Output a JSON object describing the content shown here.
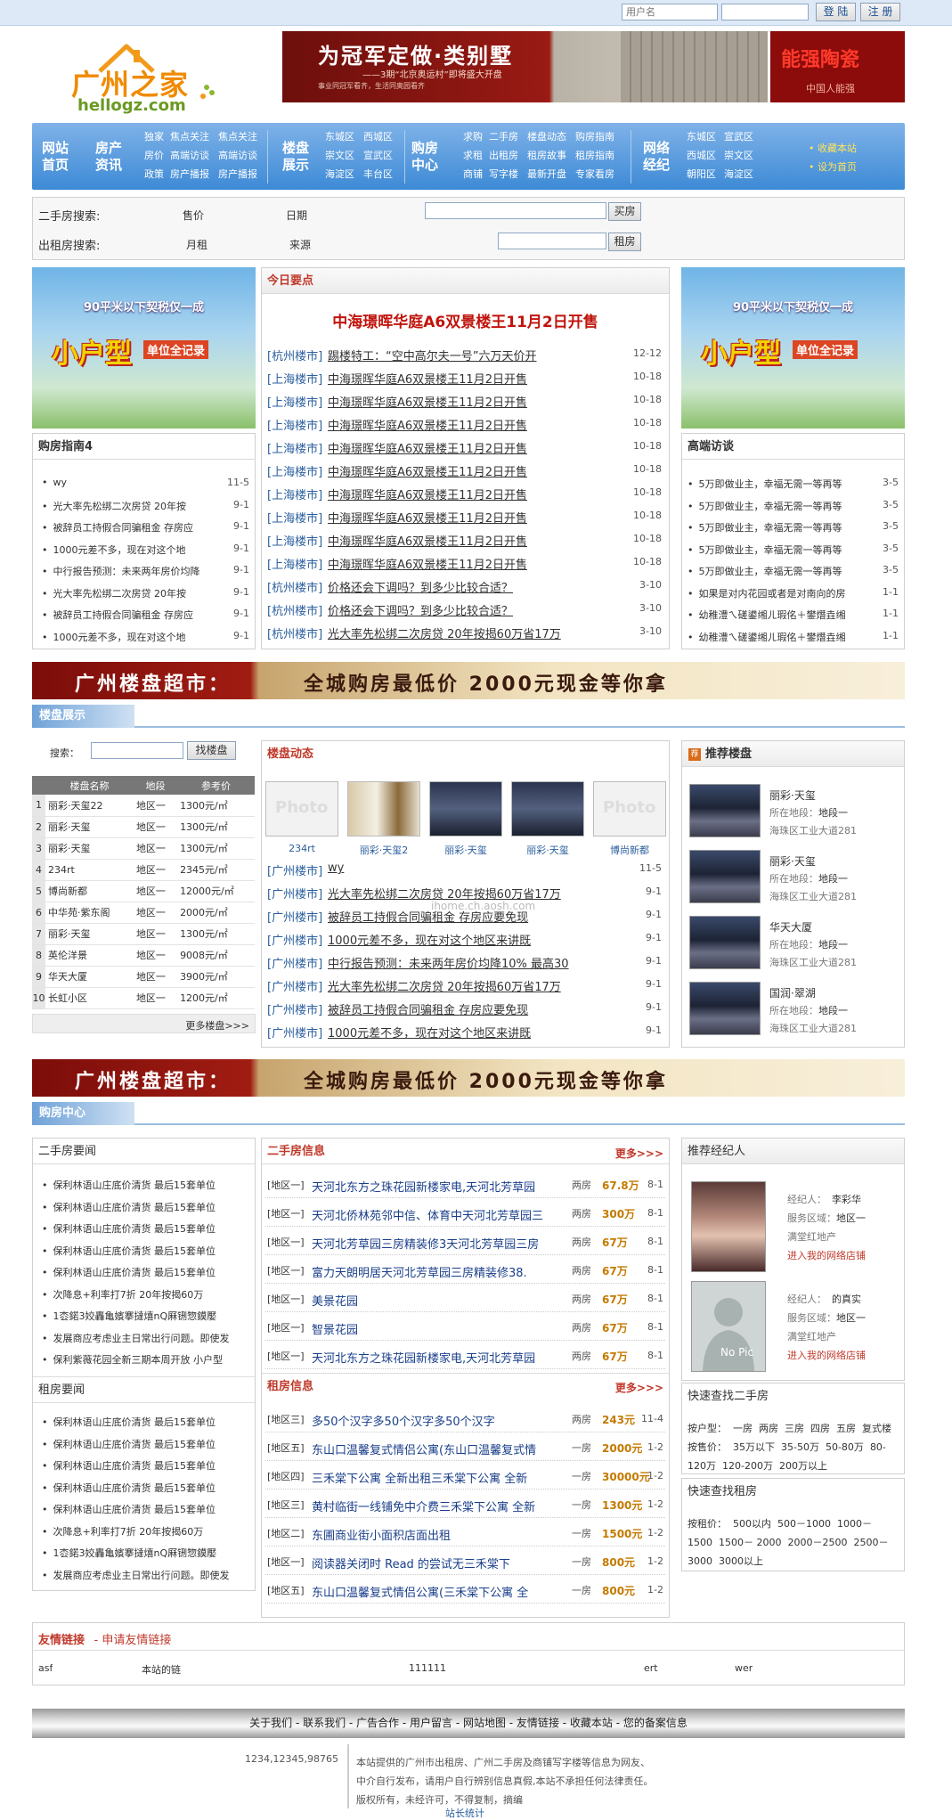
{
  "topbar": {
    "username_placeholder": "用户名",
    "login": "登 陆",
    "register": "注 册"
  },
  "logo": {
    "cn": "广州之家",
    "en": "hellogz.com"
  },
  "header_banner": {
    "headline": "为冠军定做·类别墅",
    "sub": "——3期“北京奥运村”即将盛大开盘",
    "fine": "事业同冠军看齐，生活同奥园看齐",
    "side": "能强陶瓷",
    "side_sub": "中国人能强"
  },
  "nav": {
    "groups": [
      {
        "big": [
          "网站",
          "首页"
        ]
      },
      {
        "big": [
          "房产",
          "资讯"
        ]
      },
      {
        "big": [
          "楼盘",
          "展示"
        ]
      },
      {
        "big": [
          "购房",
          "中心"
        ]
      },
      {
        "big": [
          "网络",
          "经纪"
        ]
      }
    ],
    "col1": [
      "独家",
      "房价",
      "政策"
    ],
    "col2": [
      "焦点关注",
      "高端访谈",
      "房产播报"
    ],
    "col3": [
      "焦点关注",
      "高端访谈",
      "房产播报"
    ],
    "col4": [
      "东城区",
      "崇文区",
      "海淀区"
    ],
    "col5": [
      "西城区",
      "宣武区",
      "丰台区"
    ],
    "col6": [
      "求购",
      "求租",
      "商铺"
    ],
    "col7": [
      "二手房",
      "出租房",
      "写字楼"
    ],
    "col8": [
      "楼盘动态",
      "租房故事",
      "最新开盘"
    ],
    "col9": [
      "购房指南",
      "租房指南",
      "专家看房"
    ],
    "col10": [
      "东城区",
      "西城区",
      "朝阳区"
    ],
    "col11": [
      "宣武区",
      "崇文区",
      "海淀区"
    ],
    "extra": [
      "收藏本站",
      "设为首页"
    ]
  },
  "search": {
    "used_label": "二手房搜索:",
    "used_f1": "售价",
    "used_f2": "日期",
    "used_btn": "买房",
    "rent_label": "出租房搜索:",
    "rent_f1": "月租",
    "rent_f2": "来源",
    "rent_btn": "租房"
  },
  "ad": {
    "line1": "90平米以下契税仅一成",
    "big": "小户型",
    "tag": "单位全记录"
  },
  "guide": {
    "title": "购房指南4",
    "items": [
      {
        "t": "wy",
        "d": "11-5"
      },
      {
        "t": "光大率先松绑二次房贷 20年按",
        "d": "9-1"
      },
      {
        "t": "被辞员工持假合同骗租金 存房应",
        "d": "9-1"
      },
      {
        "t": "1000元差不多，现在对这个地",
        "d": "9-1"
      },
      {
        "t": "中行报告预测：未来两年房价均降",
        "d": "9-1"
      },
      {
        "t": "光大率先松绑二次房贷 20年按",
        "d": "9-1"
      },
      {
        "t": "被辞员工持假合同骗租金 存房应",
        "d": "9-1"
      },
      {
        "t": "1000元差不多，现在对这个地",
        "d": "9-1"
      }
    ]
  },
  "today": {
    "title": "今日要点",
    "headline": "中海璟晖华庭A6双景楼王11月2日开售",
    "items": [
      {
        "c": "[杭州楼市]",
        "t": "踢楼特工：“空中高尔夫一号”六万天价开",
        "d": "12-12"
      },
      {
        "c": "[上海楼市]",
        "t": "中海璟晖华庭A6双景楼王11月2日开售",
        "d": "10-18"
      },
      {
        "c": "[上海楼市]",
        "t": "中海璟晖华庭A6双景楼王11月2日开售",
        "d": "10-18"
      },
      {
        "c": "[上海楼市]",
        "t": "中海璟晖华庭A6双景楼王11月2日开售",
        "d": "10-18"
      },
      {
        "c": "[上海楼市]",
        "t": "中海璟晖华庭A6双景楼王11月2日开售",
        "d": "10-18"
      },
      {
        "c": "[上海楼市]",
        "t": "中海璟晖华庭A6双景楼王11月2日开售",
        "d": "10-18"
      },
      {
        "c": "[上海楼市]",
        "t": "中海璟晖华庭A6双景楼王11月2日开售",
        "d": "10-18"
      },
      {
        "c": "[上海楼市]",
        "t": "中海璟晖华庭A6双景楼王11月2日开售",
        "d": "10-18"
      },
      {
        "c": "[上海楼市]",
        "t": "中海璟晖华庭A6双景楼王11月2日开售",
        "d": "10-18"
      },
      {
        "c": "[上海楼市]",
        "t": "中海璟晖华庭A6双景楼王11月2日开售",
        "d": "10-18"
      },
      {
        "c": "[杭州楼市]",
        "t": "价格还会下调吗？到多少比较合适？",
        "d": "3-10"
      },
      {
        "c": "[杭州楼市]",
        "t": "价格还会下调吗？到多少比较合适？",
        "d": "3-10"
      },
      {
        "c": "[杭州楼市]",
        "t": "光大率先松绑二次房贷 20年按揭60万省17万",
        "d": "3-10"
      }
    ]
  },
  "interview": {
    "title": "高端访谈",
    "items": [
      {
        "t": "5万即做业主，幸福无需一等再等",
        "d": "3-5"
      },
      {
        "t": "5万即做业主，幸福无需一等再等",
        "d": "3-5"
      },
      {
        "t": "5万即做业主，幸福无需一等再等",
        "d": "3-5"
      },
      {
        "t": "5万即做业主，幸福无需一等再等",
        "d": "3-5"
      },
      {
        "t": "5万即做业主，幸福无需一等再等",
        "d": "3-5"
      },
      {
        "t": "如果是对内花园或者是对南向的房",
        "d": "1-1"
      },
      {
        "t": "幼稚澧ㄟ磋鍙缃ㄦ瑕佲＋鐢熸垚缃",
        "d": "1-1"
      },
      {
        "t": "幼稚澧ㄟ磋鍙缃ㄦ瑕佲＋鐢熸垚缃",
        "d": "1-1"
      }
    ]
  },
  "banner": {
    "left": "广州楼盘超市：",
    "right": "全城购房最低价 2000元现金等你拿"
  },
  "sect1": "楼盘展示",
  "sect2": "购房中心",
  "listing": {
    "search_label": "搜索：",
    "search_btn": "找楼盘",
    "headers": [
      "楼盘名称",
      "地段",
      "参考价"
    ],
    "rows": [
      {
        "n": "1",
        "name": "丽彩·天玺22",
        "area": "地区一",
        "p": "1300元/㎡"
      },
      {
        "n": "2",
        "name": "丽彩·天玺",
        "area": "地区一",
        "p": "1300元/㎡"
      },
      {
        "n": "3",
        "name": "丽彩·天玺",
        "area": "地区一",
        "p": "1300元/㎡"
      },
      {
        "n": "4",
        "name": "234rt",
        "area": "地区一",
        "p": "2345元/㎡"
      },
      {
        "n": "5",
        "name": "博尚新都",
        "area": "地区一",
        "p": "12000元/㎡"
      },
      {
        "n": "6",
        "name": "中华苑·紫东阁",
        "area": "地区一",
        "p": "2000元/㎡"
      },
      {
        "n": "7",
        "name": "丽彩·天玺",
        "area": "地区一",
        "p": "1300元/㎡"
      },
      {
        "n": "8",
        "name": "英伦洋景",
        "area": "地区一",
        "p": "9008元/㎡"
      },
      {
        "n": "9",
        "name": "华天大厦",
        "area": "地区一",
        "p": "3900元/㎡"
      },
      {
        "n": "10",
        "name": "长虹小区",
        "area": "地区一",
        "p": "1200元/㎡"
      }
    ],
    "more": "更多楼盘>>>"
  },
  "dynamics": {
    "title": "楼盘动态",
    "photos": [
      "234rt",
      "丽彩·天玺2",
      "丽彩·天玺",
      "丽彩·天玺",
      "博尚新都"
    ],
    "photo_placeholder": "Photo",
    "watermark": "ihome.ch.aosh.com",
    "items": [
      {
        "c": "[广州楼市]",
        "t": "wy",
        "d": "11-5"
      },
      {
        "c": "[广州楼市]",
        "t": "光大率先松绑二次房贷 20年按揭60万省17万",
        "d": "9-1"
      },
      {
        "c": "[广州楼市]",
        "t": "被辞员工持假合同骗租金 存房应要免现",
        "d": "9-1"
      },
      {
        "c": "[广州楼市]",
        "t": "1000元差不多，现在对这个地区来讲既",
        "d": "9-1"
      },
      {
        "c": "[广州楼市]",
        "t": "中行报告预测：未来两年房价均降10% 最高30",
        "d": "9-1"
      },
      {
        "c": "[广州楼市]",
        "t": "光大率先松绑二次房贷 20年按揭60万省17万",
        "d": "9-1"
      },
      {
        "c": "[广州楼市]",
        "t": "被辞员工持假合同骗租金 存房应要免现",
        "d": "9-1"
      },
      {
        "c": "[广州楼市]",
        "t": "1000元差不多，现在对这个地区来讲既",
        "d": "9-1"
      }
    ]
  },
  "recommend": {
    "title": "推荐楼盘",
    "loc_label": "所在地段：",
    "addr_label": "",
    "items": [
      {
        "name": "丽彩·天玺",
        "loc": "地段一",
        "addr": "海珠区工业大道281"
      },
      {
        "name": "丽彩·天玺",
        "loc": "地段一",
        "addr": "海珠区工业大道281"
      },
      {
        "name": "华天大厦",
        "loc": "地段一",
        "addr": "海珠区工业大道281"
      },
      {
        "name": "国润·翠湖",
        "loc": "地段一",
        "addr": "海珠区工业大道281"
      }
    ]
  },
  "used_news": {
    "title": "二手房要闻",
    "items": [
      "保利林语山庄底价清货 最后15套单位",
      "保利林语山庄底价清货 最后15套单位",
      "保利林语山庄底价清货 最后15套单位",
      "保利林语山庄底价清货 最后15套单位",
      "保利林语山庄底价清货 最后15套单位",
      "次降息+利率打7折 20年按揭60万",
      "1枩鍩3姣轟亀嬪搴撻熺nQ厤铏惣鏌嬮",
      "发展商应考虑业主日常出行问题。即使发",
      "保利紫薇花园全新三期本周开放 小户型"
    ]
  },
  "rent_news": {
    "title": "租房要闻",
    "items": [
      "保利林语山庄底价清货 最后15套单位",
      "保利林语山庄底价清货 最后15套单位",
      "保利林语山庄底价清货 最后15套单位",
      "保利林语山庄底价清货 最后15套单位",
      "保利林语山庄底价清货 最后15套单位",
      "次降息+利率打7折 20年按揭60万",
      "1枩鍩3姣轟亀嬪搴撻熺nQ厤铏惣鏌嬮",
      "发展商应考虑业主日常出行问题。即使发"
    ]
  },
  "used_info": {
    "title": "二手房信息",
    "more": "更多>>>",
    "items": [
      {
        "a": "[地区一]",
        "t": "天河北东方之珠花园新楼家电,天河北芳草园",
        "r": "两房",
        "p": "67.8万",
        "d": "8-1"
      },
      {
        "a": "[地区一]",
        "t": "天河北侨林苑邻中信、体育中天河北芳草园三",
        "r": "两房",
        "p": "300万",
        "d": "8-1"
      },
      {
        "a": "[地区一]",
        "t": "天河北芳草园三房精装修3天河北芳草园三房",
        "r": "两房",
        "p": "67万",
        "d": "8-1"
      },
      {
        "a": "[地区一]",
        "t": "富力天朗明居天河北芳草园三房精装修38.",
        "r": "两房",
        "p": "67万",
        "d": "8-1"
      },
      {
        "a": "[地区一]",
        "t": "美景花园",
        "r": "两房",
        "p": "67万",
        "d": "8-1"
      },
      {
        "a": "[地区一]",
        "t": "智景花园",
        "r": "两房",
        "p": "67万",
        "d": "8-1"
      },
      {
        "a": "[地区一]",
        "t": "天河北东方之珠花园新楼家电,天河北芳草园",
        "r": "两房",
        "p": "67万",
        "d": "8-1"
      }
    ]
  },
  "rent_info": {
    "title": "租房信息",
    "more": "更多>>>",
    "items": [
      {
        "a": "[地区三]",
        "t": "多50个汉字多50个汉字多50个汉字",
        "r": "两房",
        "p": "243元",
        "d": "11-4"
      },
      {
        "a": "[地区五]",
        "t": "东山口温馨复式情侣公寓(东山口温馨复式情",
        "r": "一房",
        "p": "2000元",
        "d": "1-2"
      },
      {
        "a": "[地区四]",
        "t": "三禾棠下公寓 全新出租三禾棠下公寓 全新",
        "r": "一房",
        "p": "30000元",
        "d": "1-2"
      },
      {
        "a": "[地区三]",
        "t": "黄村临街一线铺免中介费三禾棠下公寓 全新",
        "r": "一房",
        "p": "1300元",
        "d": "1-2"
      },
      {
        "a": "[地区二]",
        "t": "东圃商业街小面积店面出租",
        "r": "一房",
        "p": "1500元",
        "d": "1-2"
      },
      {
        "a": "[地区一]",
        "t": "阅读器关闭时 Read 的尝试无三禾棠下",
        "r": "一房",
        "p": "800元",
        "d": "1-2"
      },
      {
        "a": "[地区五]",
        "t": "东山口温馨复式情侣公寓(三禾棠下公寓 全",
        "r": "一房",
        "p": "800元",
        "d": "1-2"
      }
    ]
  },
  "agent": {
    "title": "推荐经纪人",
    "name_label": "经纪人：",
    "area_label": "服务区域：",
    "company": "满堂红地产",
    "shop_link": "进入我的网络店铺",
    "nopic": "No Pic",
    "items": [
      {
        "name": "李彩华",
        "area": "地区一"
      },
      {
        "name": "的真实",
        "area": "地区一"
      }
    ]
  },
  "quick_used": {
    "title": "快速查找二手房",
    "type_label": "按户型：",
    "types": [
      "一房",
      "两房",
      "三房",
      "四房",
      "五房",
      "复式楼"
    ],
    "price_label": "按售价：",
    "prices": [
      "35万以下",
      "35-50万",
      "50-80万",
      "80-120万",
      "120-200万",
      "200万以上"
    ]
  },
  "quick_rent": {
    "title": "快速查找租房",
    "price_label": "按租价：",
    "prices": [
      "500以内",
      "500－1000",
      "1000－1500",
      "1500－ 2000",
      "2000－2500",
      "2500－3000",
      "3000以上"
    ]
  },
  "links": {
    "title": "友情链接",
    "apply": "- 申请友情链接",
    "items": [
      "asf",
      "本站的链",
      "111111",
      "ert",
      "wer"
    ]
  },
  "footer": {
    "nav": "关于我们 - 联系我们 - 广告合作 - 用户留言 - 网站地图 - 友情链接 - 收藏本站 - 您的备案信息",
    "phone": "1234,12345,98765",
    "l1": "本站提供的广州市出租房、广州二手房及商铺写字楼等信息为网友、",
    "l2": "中介自行发布，请用户自行辨别信息真假,本站不承担任何法律责任。",
    "l3": "版权所有，未经许可，不得复制，摘编",
    "stat": "站长统计"
  }
}
